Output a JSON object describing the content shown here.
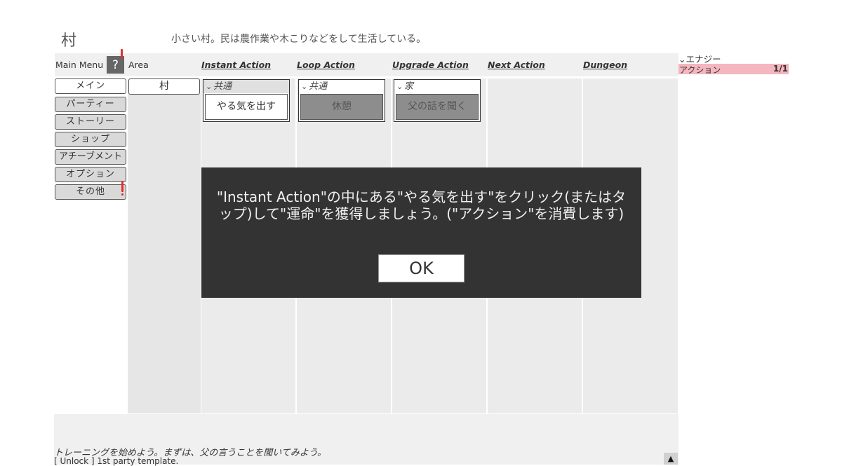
{
  "area": {
    "title": "村",
    "description": "小さい村。民は農作業や木こりなどをして生活している。"
  },
  "headers": {
    "main_menu": "Main Menu",
    "help": "?",
    "area": "Area",
    "instant_action": "Instant Action",
    "loop_action": "Loop Action",
    "upgrade_action": "Upgrade Action",
    "next_action": "Next Action",
    "dungeon": "Dungeon"
  },
  "menu": {
    "items": [
      "メイン",
      "パーティー",
      "ストーリー",
      "ショップ",
      "アチーブメント",
      "オプション",
      "その他"
    ]
  },
  "area_list": [
    "村"
  ],
  "instant": {
    "group": "共通",
    "action": "やる気を出す"
  },
  "loop": {
    "group": "共通",
    "action": "休憩"
  },
  "upgrade": {
    "group": "家",
    "action": "父の話を聞く"
  },
  "resources": {
    "energy_label": "エナジー",
    "action_name": "アクション",
    "action_value": "1/1"
  },
  "modal": {
    "message": "\"Instant Action\"の中にある\"やる気を出す\"をクリック(またはタップ)して\"運命\"を獲得しましょう。(\"アクション\"を消費します)",
    "ok": "OK"
  },
  "log": {
    "line1": "トレーニングを始めよう。まずは、父の言うことを聞いてみよう。",
    "line2": "[ Unlock ] 1st party template."
  },
  "colors": {
    "modal_bg": "#333333",
    "action_bar": "#f4b6bf",
    "alert": "#e03030",
    "disabled_button": "#8d8d8d"
  }
}
